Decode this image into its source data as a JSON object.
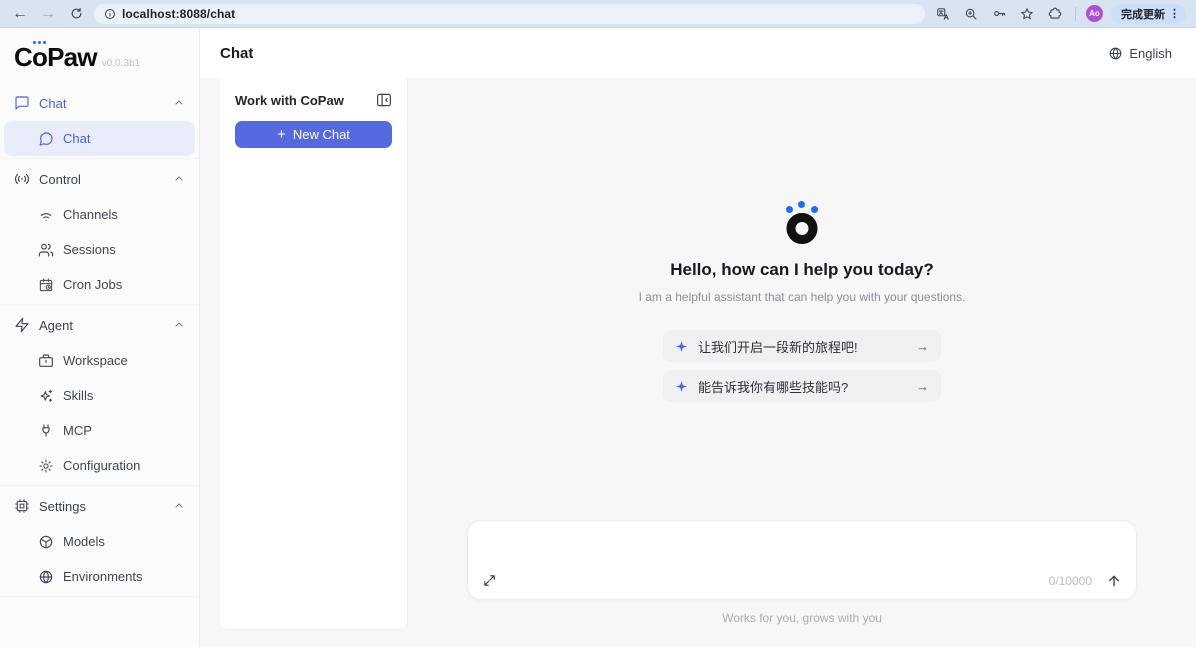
{
  "browser": {
    "url": "localhost:8088/chat",
    "avatar_text": "Ao",
    "update_button_label": "完成更新",
    "menu_dots": "⋮",
    "back_glyph": "←",
    "forward_glyph": "→"
  },
  "brand": {
    "logo_c": "C",
    "logo_o": "o",
    "logo_rest": "Paw",
    "version": "v0.0.3b1"
  },
  "sidebar": {
    "sections": [
      {
        "label": "Chat"
      },
      {
        "label": "Control"
      },
      {
        "label": "Agent"
      },
      {
        "label": "Settings"
      }
    ],
    "items": {
      "chat": "Chat",
      "channels": "Channels",
      "sessions": "Sessions",
      "cron_jobs": "Cron Jobs",
      "workspace": "Workspace",
      "skills": "Skills",
      "mcp": "MCP",
      "configuration": "Configuration",
      "models": "Models",
      "environments": "Environments"
    }
  },
  "header": {
    "title": "Chat",
    "language_label": "English"
  },
  "chat_panel": {
    "title": "Work with CoPaw",
    "new_chat_label": "New Chat",
    "plus_glyph": "+"
  },
  "main": {
    "greeting_title": "Hello, how can I help you today?",
    "greeting_subtitle": "I am a helpful assistant that can help you with your questions.",
    "suggestions": [
      {
        "text": "让我们开启一段新的旅程吧!",
        "arrow": "→"
      },
      {
        "text": "能告诉我你有哪些技能吗?",
        "arrow": "→"
      }
    ],
    "composer": {
      "char_counter": "0/10000"
    },
    "footer_tagline": "Works for you, grows with you"
  },
  "colors": {
    "accent": "#5669de",
    "brand_dot_blue": "#1d6ef2",
    "selected_item_bg": "#e9edfa",
    "avatar_purple": "#b04fd6",
    "toolbar_bg": "#d9e4f3"
  }
}
